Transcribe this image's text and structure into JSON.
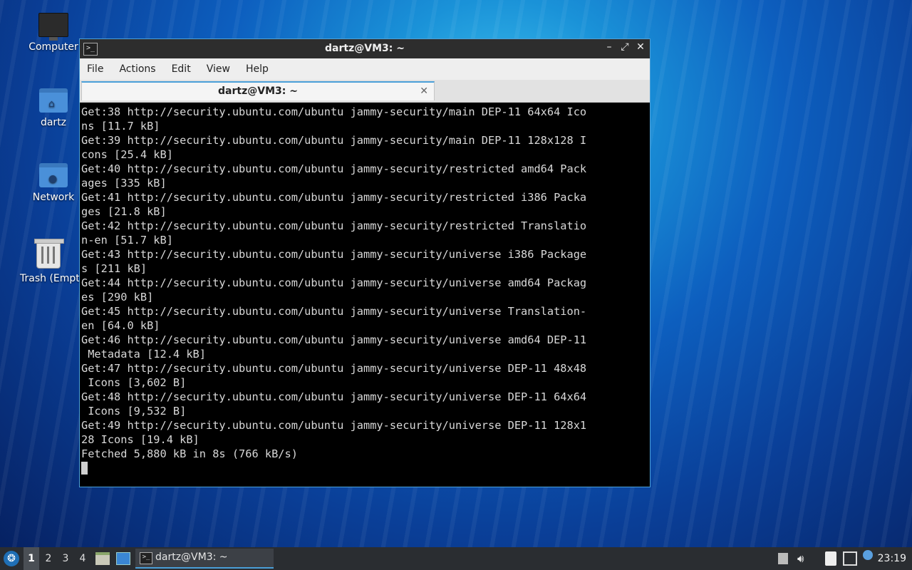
{
  "desktop": {
    "icons": [
      {
        "label": "Computer",
        "icon": "computer-icon"
      },
      {
        "label": "dartz",
        "icon": "home-folder-icon"
      },
      {
        "label": "Network",
        "icon": "network-folder-icon"
      },
      {
        "label": "Trash (Empty)",
        "icon": "trash-icon"
      }
    ]
  },
  "window": {
    "title": "dartz@VM3: ~",
    "controls": {
      "minimize": "–",
      "maximize": "⤢",
      "close": "✕"
    },
    "menu": [
      "File",
      "Actions",
      "Edit",
      "View",
      "Help"
    ],
    "tab": {
      "label": "dartz@VM3: ~",
      "close": "✕"
    }
  },
  "terminal": {
    "lines": [
      "Get:38 http://security.ubuntu.com/ubuntu jammy-security/main DEP-11 64x64 Ico",
      "ns [11.7 kB]",
      "Get:39 http://security.ubuntu.com/ubuntu jammy-security/main DEP-11 128x128 I",
      "cons [25.4 kB]",
      "Get:40 http://security.ubuntu.com/ubuntu jammy-security/restricted amd64 Pack",
      "ages [335 kB]",
      "Get:41 http://security.ubuntu.com/ubuntu jammy-security/restricted i386 Packa",
      "ges [21.8 kB]",
      "Get:42 http://security.ubuntu.com/ubuntu jammy-security/restricted Translatio",
      "n-en [51.7 kB]",
      "Get:43 http://security.ubuntu.com/ubuntu jammy-security/universe i386 Package",
      "s [211 kB]",
      "Get:44 http://security.ubuntu.com/ubuntu jammy-security/universe amd64 Packag",
      "es [290 kB]",
      "Get:45 http://security.ubuntu.com/ubuntu jammy-security/universe Translation-",
      "en [64.0 kB]",
      "Get:46 http://security.ubuntu.com/ubuntu jammy-security/universe amd64 DEP-11",
      " Metadata [12.4 kB]",
      "Get:47 http://security.ubuntu.com/ubuntu jammy-security/universe DEP-11 48x48",
      " Icons [3,602 B]",
      "Get:48 http://security.ubuntu.com/ubuntu jammy-security/universe DEP-11 64x64",
      " Icons [9,532 B]",
      "Get:49 http://security.ubuntu.com/ubuntu jammy-security/universe DEP-11 128x1",
      "28 Icons [19.4 kB]",
      "Fetched 5,880 kB in 8s (766 kB/s)"
    ]
  },
  "taskbar": {
    "workspaces": [
      "1",
      "2",
      "3",
      "4"
    ],
    "active_workspace": "1",
    "task_label": "dartz@VM3: ~",
    "clock": "23:19"
  },
  "colors": {
    "accent": "#4a9fd8",
    "terminal_bg": "#000000",
    "terminal_fg": "#d8d8d8"
  }
}
